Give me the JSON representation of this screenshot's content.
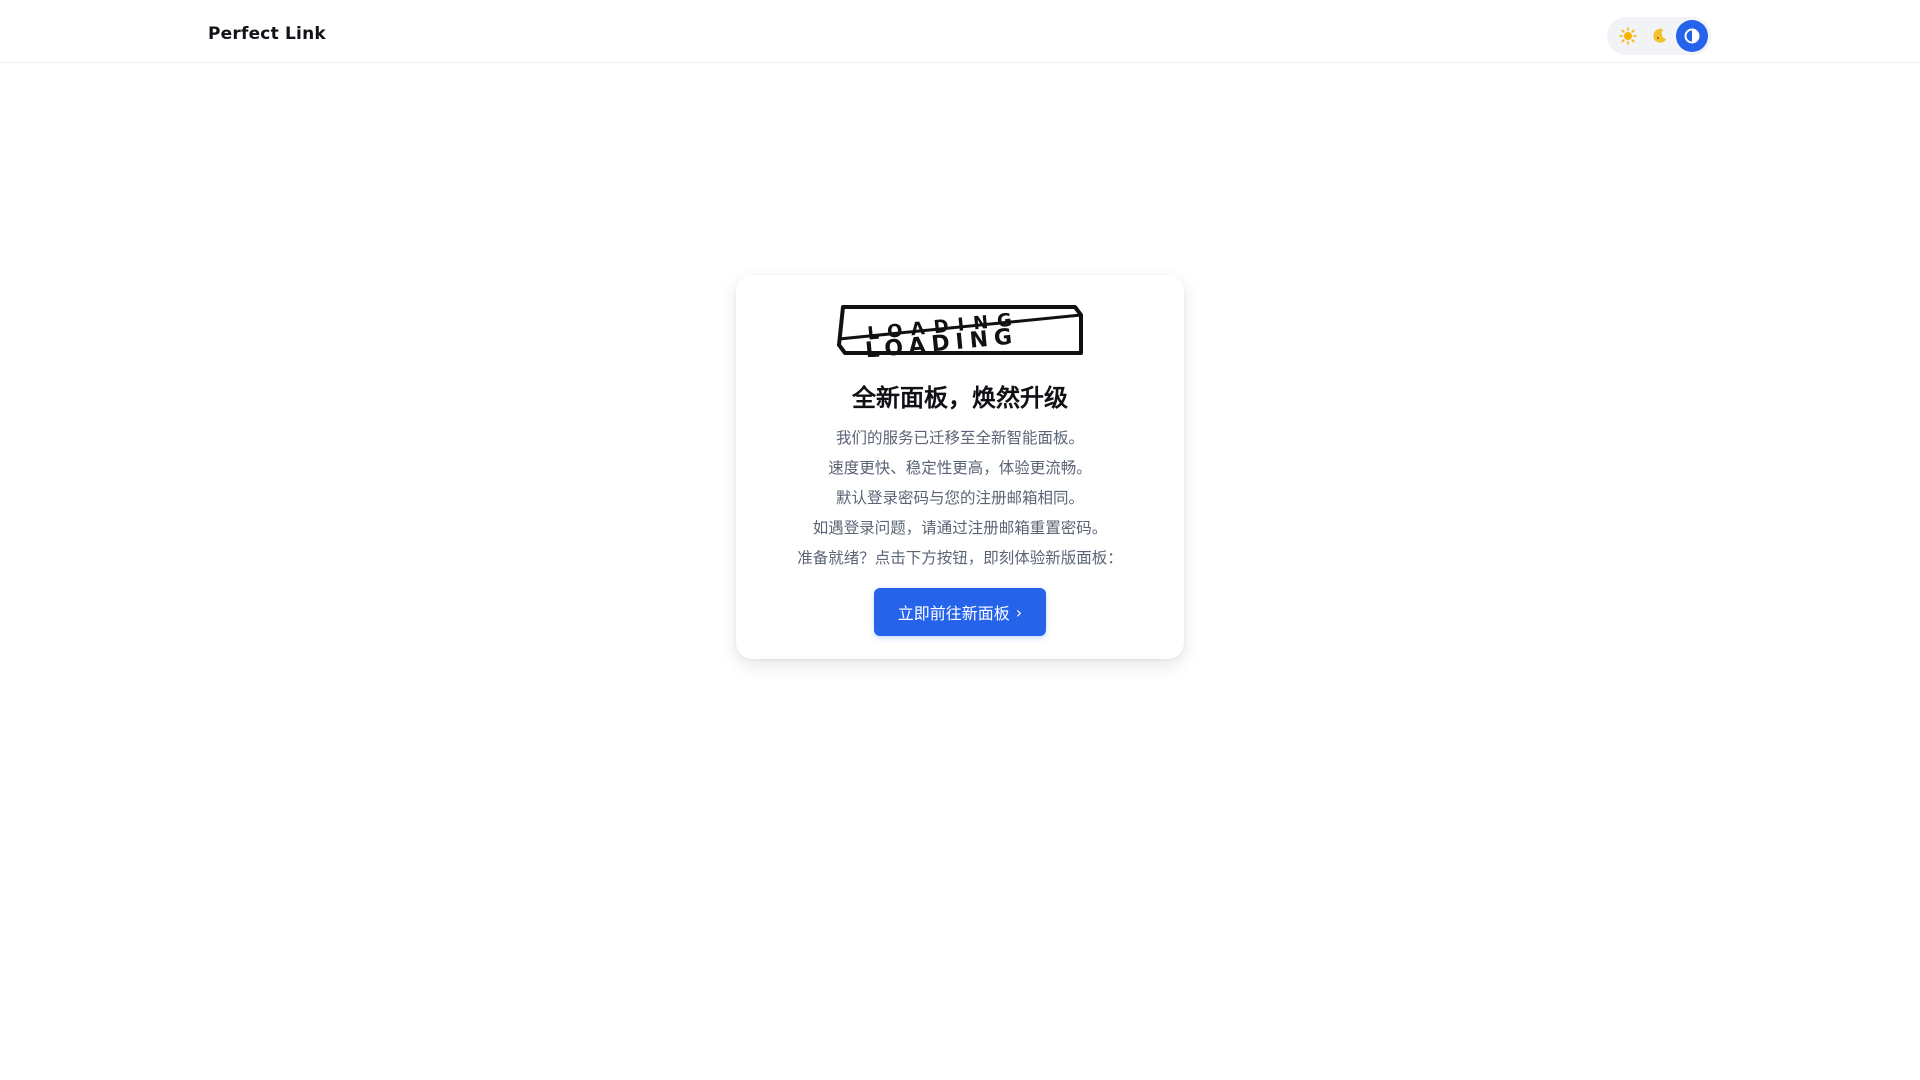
{
  "header": {
    "brand": "Perfect Link",
    "theme_toggle": {
      "options": [
        {
          "name": "light",
          "icon": "sun-icon",
          "glyph": "🌞"
        },
        {
          "name": "dark",
          "icon": "moon-icon",
          "glyph": "🌛"
        },
        {
          "name": "auto",
          "icon": "half-circle-icon",
          "glyph": "◐"
        }
      ],
      "selected": "auto",
      "accent": "#2563eb"
    }
  },
  "card": {
    "logo_text_top": "LOADING",
    "logo_text_bottom": "LOADING",
    "title": "全新面板，焕然升级",
    "lines": [
      "我们的服务已迁移至全新智能面板。",
      "速度更快、稳定性更高，体验更流畅。",
      "默认登录密码与您的注册邮箱相同。",
      "如遇登录问题，请通过注册邮箱重置密码。",
      "准备就绪？点击下方按钮，即刻体验新版面板："
    ],
    "button_label": "立即前往新面板",
    "button_chevron": "›"
  },
  "colors": {
    "primary": "#2563eb",
    "text_muted": "#5b6475",
    "title": "#0f1115"
  }
}
